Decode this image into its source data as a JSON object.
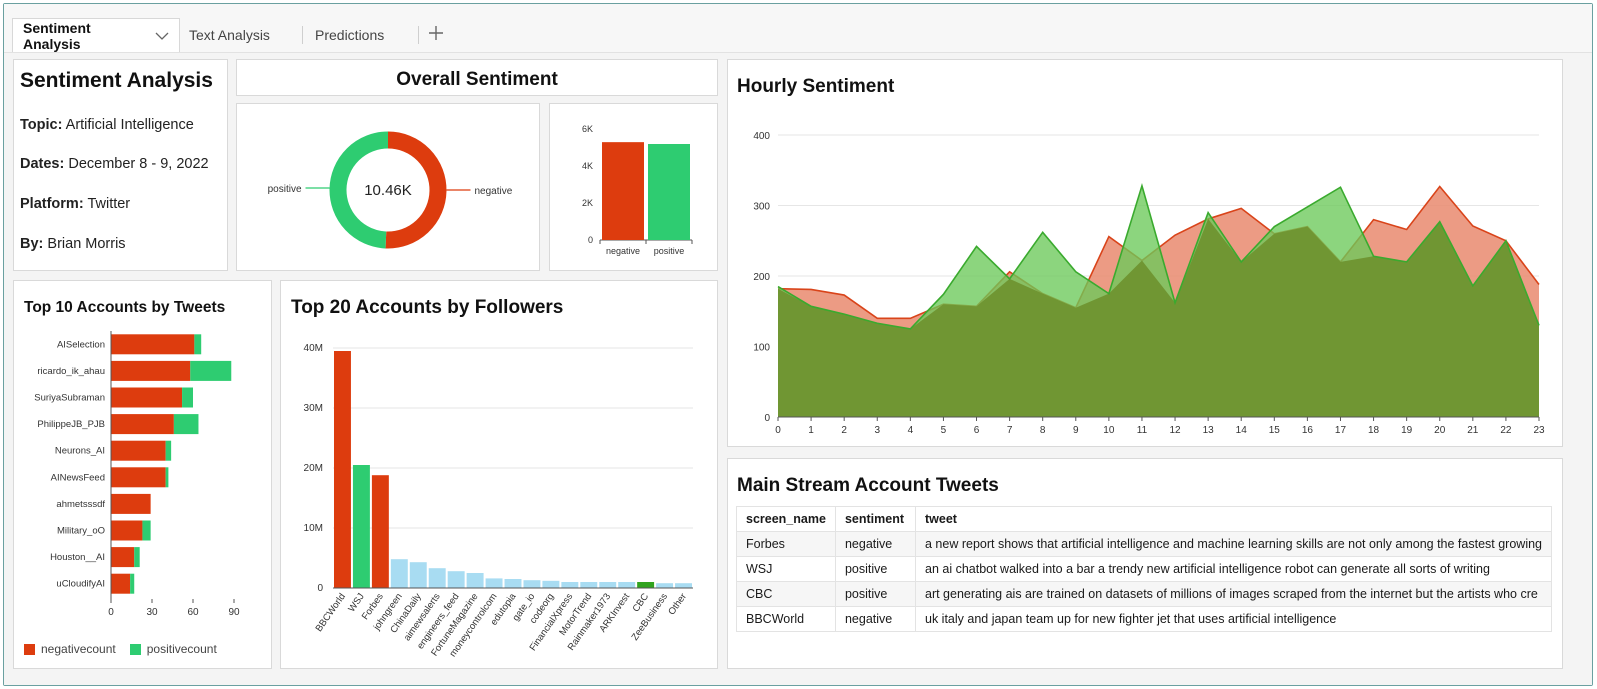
{
  "tabs": [
    {
      "label": "Sentiment Analysis",
      "active": true
    },
    {
      "label": "Text Analysis",
      "active": false
    },
    {
      "label": "Predictions",
      "active": false
    }
  ],
  "colors": {
    "negative": "#dd3c0e",
    "positive": "#2ecc71",
    "light_blue": "#a8dcf2",
    "hourly_neg_fill": "#e9896e",
    "hourly_pos_fill": "#6cc95a",
    "hourly_neg_line": "#d9441a",
    "hourly_pos_line": "#3aaa2e"
  },
  "info": {
    "title": "Sentiment Analysis",
    "topic_label": "Topic:",
    "topic": "Artificial Intelligence",
    "dates_label": "Dates:",
    "dates": "December 8 - 9, 2022",
    "platform_label": "Platform:",
    "platform": "Twitter",
    "by_label": "By:",
    "by": "Brian Morris"
  },
  "overall": {
    "title": "Overall Sentiment",
    "donut": {
      "center_label": "10.46K",
      "positive_label": "positive",
      "negative_label": "negative",
      "negative": 5300,
      "positive": 5160
    },
    "bar": {
      "categories": [
        "negative",
        "positive"
      ],
      "values": [
        5300,
        5200
      ],
      "ticks": [
        "0",
        "2K",
        "4K",
        "6K"
      ],
      "tick_values": [
        0,
        2000,
        4000,
        6000
      ],
      "ylim": [
        0,
        6500
      ]
    }
  },
  "top10": {
    "title": "Top 10 Accounts by Tweets",
    "chart_data": {
      "type": "bar",
      "categories": [
        "AISelection",
        "ricardo_ik_ahau",
        "SuriyaSubraman",
        "PhilippeJB_PJB",
        "Neurons_AI",
        "AINewsFeed",
        "ahmetsssdf",
        "Military_oO",
        "Houston__AI",
        "uCloudifyAI"
      ],
      "series": [
        {
          "name": "negativecount",
          "values": [
            61,
            58,
            52,
            46,
            40,
            40,
            29,
            23,
            17,
            14
          ]
        },
        {
          "name": "positivecount",
          "values": [
            5,
            30,
            8,
            18,
            4,
            2,
            0,
            6,
            4,
            3
          ]
        }
      ],
      "ticks": [
        "0",
        "30",
        "60",
        "90"
      ],
      "tick_values": [
        0,
        30,
        60,
        90
      ],
      "xlim": [
        0,
        90
      ]
    },
    "legend": [
      "negativecount",
      "positivecount"
    ]
  },
  "top20": {
    "title": "Top 20 Accounts by Followers",
    "chart_data": {
      "type": "bar",
      "categories": [
        "BBCWorld",
        "WSJ",
        "Forbes",
        "johngreen",
        "ChinaDaily",
        "aimewsalerts",
        "engineers_feed",
        "FortuneMagazine",
        "moneycontrolcom",
        "edutopia",
        "gate_io",
        "codeorg",
        "FinancialXpress",
        "MotorTrend",
        "Rainmaker1973",
        "ARKInvest",
        "CBC",
        "ZeeBusiness",
        "Other"
      ],
      "values": [
        39.5,
        20.5,
        18.8,
        4.8,
        4.3,
        3.3,
        2.8,
        2.5,
        1.6,
        1.5,
        1.3,
        1.2,
        1.0,
        1.0,
        1.0,
        1.0,
        1.0,
        0.8,
        0.8
      ],
      "color_group": [
        "negative",
        "positive",
        "negative",
        "light",
        "light",
        "light",
        "light",
        "light",
        "light",
        "light",
        "light",
        "light",
        "light",
        "light",
        "light",
        "light",
        "positive_dark",
        "light",
        "light"
      ],
      "ticks": [
        "0",
        "10M",
        "20M",
        "30M",
        "40M"
      ],
      "tick_values": [
        0,
        10,
        20,
        30,
        40
      ],
      "ylim": [
        0,
        42
      ]
    }
  },
  "hourly": {
    "title": "Hourly Sentiment",
    "chart_data": {
      "type": "area",
      "x": [
        0,
        1,
        2,
        3,
        4,
        5,
        6,
        7,
        8,
        9,
        10,
        11,
        12,
        13,
        14,
        15,
        16,
        17,
        18,
        19,
        20,
        21,
        22,
        23
      ],
      "series": [
        {
          "name": "negative",
          "values": [
            182,
            181,
            173,
            140,
            140,
            160,
            157,
            206,
            175,
            155,
            256,
            222,
            258,
            281,
            296,
            260,
            270,
            220,
            280,
            266,
            327,
            271,
            250,
            188
          ]
        },
        {
          "name": "positive",
          "values": [
            185,
            157,
            146,
            133,
            125,
            174,
            242,
            196,
            262,
            206,
            175,
            328,
            162,
            290,
            220,
            270,
            298,
            326,
            228,
            220,
            277,
            186,
            250,
            130
          ]
        }
      ],
      "yticks": [
        "0",
        "100",
        "200",
        "300",
        "400"
      ],
      "ytick_values": [
        0,
        100,
        200,
        300,
        400
      ],
      "ylim": [
        0,
        410
      ]
    }
  },
  "mainstream": {
    "title": "Main Stream Account Tweets",
    "columns": [
      "screen_name",
      "sentiment",
      "tweet"
    ],
    "rows": [
      [
        "Forbes",
        "negative",
        "a new report shows that artificial intelligence and machine learning skills are not only among the fastest growing"
      ],
      [
        "WSJ",
        "positive",
        "an ai chatbot walked into a bar a trendy new artificial intelligence robot can generate all sorts of writing"
      ],
      [
        "CBC",
        "positive",
        "art generating ais are trained on datasets of millions of images scraped from the internet but the artists who cre"
      ],
      [
        "BBCWorld",
        "negative",
        "uk italy and japan team up for new fighter jet that uses artificial intelligence"
      ]
    ]
  }
}
